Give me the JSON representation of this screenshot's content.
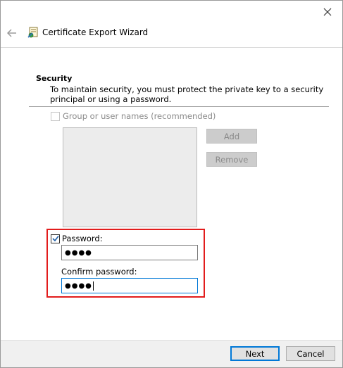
{
  "window": {
    "title": "Certificate Export Wizard",
    "close_glyph": "✕",
    "back_glyph": "←"
  },
  "section": {
    "title": "Security",
    "description": "To maintain security, you must protect the private key to a security principal or using a password."
  },
  "group": {
    "label": "Group or user names (recommended)",
    "checked": false,
    "add_label": "Add",
    "remove_label": "Remove"
  },
  "password": {
    "label": "Password:",
    "checked": true,
    "value": "●●●●",
    "confirm_label": "Confirm password:",
    "confirm_value": "●●●●"
  },
  "footer": {
    "next_label": "Next",
    "cancel_label": "Cancel"
  },
  "colors": {
    "highlight": "#e21c1c",
    "accent": "#0078d7"
  }
}
